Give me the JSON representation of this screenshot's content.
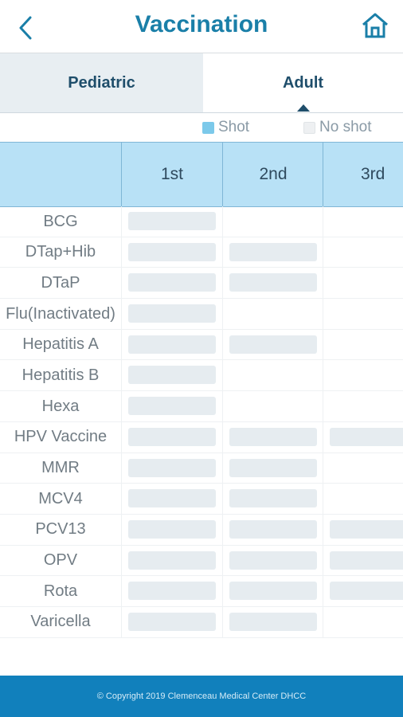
{
  "header": {
    "title": "Vaccination",
    "back_icon": "chevron-left-icon",
    "home_icon": "home-icon"
  },
  "tabs": [
    {
      "label": "Pediatric",
      "selected": false
    },
    {
      "label": "Adult",
      "selected": true
    }
  ],
  "legend": {
    "shot_label": "Shot",
    "no_shot_label": "No shot",
    "shot_color": "#7cc9ea",
    "no_shot_color": "#eef0f2"
  },
  "table": {
    "columns": [
      "1st",
      "2nd",
      "3rd"
    ],
    "rows": [
      {
        "name": "BCG",
        "doses": [
          true,
          false,
          false
        ]
      },
      {
        "name": "DTap+Hib",
        "doses": [
          true,
          true,
          false
        ]
      },
      {
        "name": "DTaP",
        "doses": [
          true,
          true,
          false
        ]
      },
      {
        "name": "Flu(Inactivated)",
        "doses": [
          true,
          false,
          false
        ]
      },
      {
        "name": "Hepatitis A",
        "doses": [
          true,
          true,
          false
        ]
      },
      {
        "name": "Hepatitis B",
        "doses": [
          true,
          false,
          false
        ]
      },
      {
        "name": "Hexa",
        "doses": [
          true,
          false,
          false
        ]
      },
      {
        "name": "HPV Vaccine",
        "doses": [
          true,
          true,
          true
        ]
      },
      {
        "name": "MMR",
        "doses": [
          true,
          true,
          false
        ]
      },
      {
        "name": "MCV4",
        "doses": [
          true,
          true,
          false
        ]
      },
      {
        "name": "PCV13",
        "doses": [
          true,
          true,
          true
        ]
      },
      {
        "name": "OPV",
        "doses": [
          true,
          true,
          true
        ]
      },
      {
        "name": "Rota",
        "doses": [
          true,
          true,
          true
        ]
      },
      {
        "name": "Varicella",
        "doses": [
          true,
          true,
          false
        ]
      }
    ]
  },
  "footer": {
    "text": "© Copyright 2019 Clemenceau Medical Center DHCC"
  }
}
